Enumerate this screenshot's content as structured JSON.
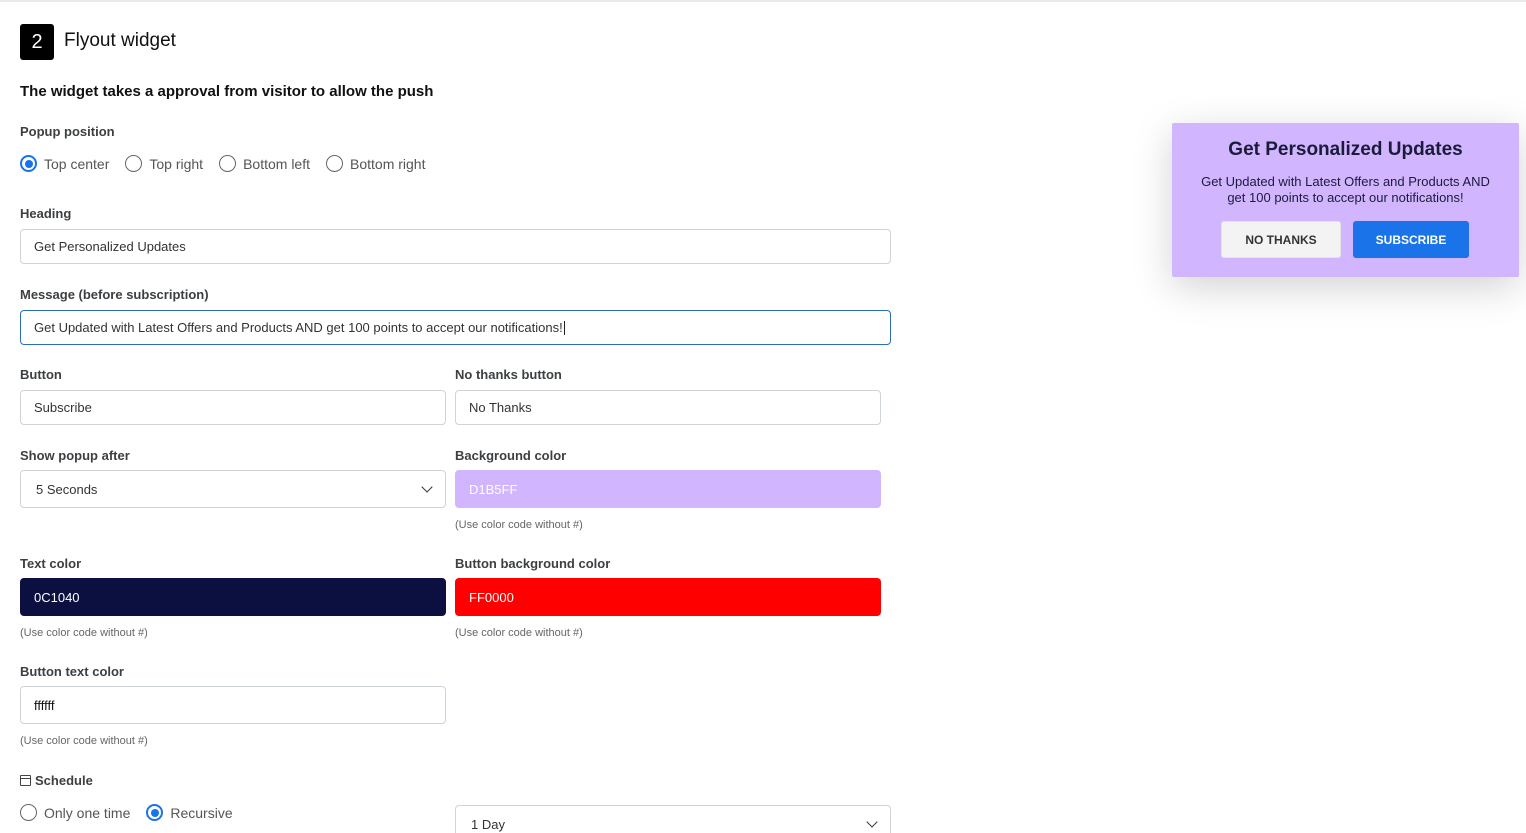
{
  "step": {
    "number": "2",
    "title": "Flyout widget"
  },
  "subtitle": "The widget takes a approval from visitor to allow the push",
  "popup_position": {
    "label": "Popup position",
    "options": [
      "Top center",
      "Top right",
      "Bottom left",
      "Bottom right"
    ],
    "selected": "Top center"
  },
  "heading": {
    "label": "Heading",
    "value": "Get Personalized Updates"
  },
  "message": {
    "label": "Message (before subscription)",
    "value": "Get Updated with Latest Offers and Products AND get 100 points to accept our notifications!"
  },
  "button": {
    "label": "Button",
    "value": "Subscribe"
  },
  "no_thanks": {
    "label": "No thanks button",
    "value": "No Thanks"
  },
  "show_after": {
    "label": "Show popup after",
    "value": "5 Seconds"
  },
  "background_color": {
    "label": "Background color",
    "value": "D1B5FF",
    "hex": "#D1B5FF",
    "hint": "(Use color code without #)"
  },
  "text_color": {
    "label": "Text color",
    "value": "0C1040",
    "hex": "#0C1040",
    "hint": "(Use color code without #)"
  },
  "button_bg_color": {
    "label": "Button background color",
    "value": "FF0000",
    "hex": "#FF0000",
    "hint": "(Use color code without #)"
  },
  "button_text_color": {
    "label": "Button text color",
    "value": "ffffff",
    "hint": "(Use color code without #)"
  },
  "schedule": {
    "label": "Schedule",
    "icon": "calendar-icon",
    "options": [
      "Only one time",
      "Recursive"
    ],
    "selected": "Recursive",
    "interval": "1 Day"
  },
  "preview": {
    "bg": "#D1B5FF",
    "text_color": "#1B1B3A",
    "heading": "Get Personalized Updates",
    "message": "Get Updated with Latest Offers and Products AND get 100 points to accept our notifications!",
    "no_thanks_label": "NO THANKS",
    "subscribe_label": "SUBSCRIBE",
    "subscribe_bg": "#1A73E8"
  }
}
